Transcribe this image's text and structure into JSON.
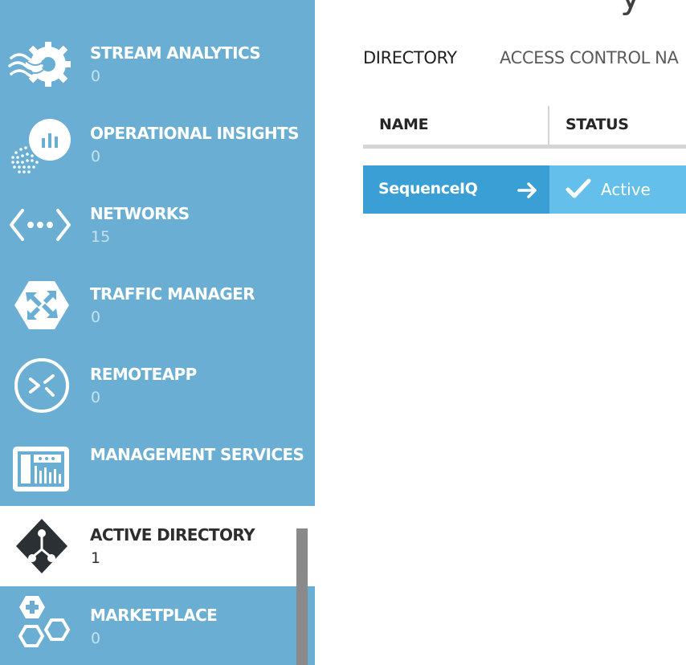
{
  "colors": {
    "sidebar_bg": "#6aaed4",
    "active_item_bg": "#ffffff",
    "row_primary": "#3a9fd4",
    "row_status": "#64c0ea"
  },
  "page": {
    "title_fragment": "y"
  },
  "sidebar": {
    "items": [
      {
        "label": "",
        "count": "0",
        "icon": "partial-icon"
      },
      {
        "label": "STREAM ANALYTICS",
        "count": "0",
        "icon": "stream-analytics-icon"
      },
      {
        "label": "OPERATIONAL INSIGHTS",
        "count": "0",
        "icon": "operational-insights-icon"
      },
      {
        "label": "NETWORKS",
        "count": "15",
        "icon": "networks-icon"
      },
      {
        "label": "TRAFFIC MANAGER",
        "count": "0",
        "icon": "traffic-manager-icon"
      },
      {
        "label": "REMOTEAPP",
        "count": "0",
        "icon": "remoteapp-icon"
      },
      {
        "label": "MANAGEMENT SERVICES",
        "count": "",
        "icon": "management-services-icon"
      },
      {
        "label": "ACTIVE DIRECTORY",
        "count": "1",
        "icon": "active-directory-icon",
        "active": true
      },
      {
        "label": "MARKETPLACE",
        "count": "0",
        "icon": "marketplace-icon"
      }
    ]
  },
  "main": {
    "tabs": [
      {
        "label": "DIRECTORY",
        "selected": true
      },
      {
        "label": "ACCESS CONTROL NA"
      }
    ],
    "table": {
      "columns": [
        "NAME",
        "STATUS"
      ],
      "rows": [
        {
          "name": "SequenceIQ",
          "status": "Active",
          "status_icon": "check-icon",
          "row_icon": "arrow-right-icon"
        }
      ]
    }
  }
}
